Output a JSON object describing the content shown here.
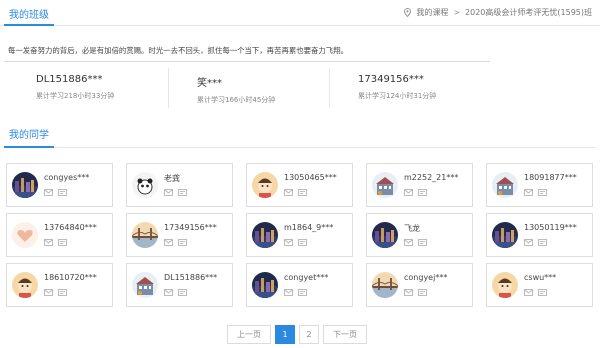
{
  "header": {
    "title": "我的班级",
    "breadcrumb": {
      "home": "我的课程",
      "separator": ">",
      "current": "2020高级会计师考评无忧(1595)班"
    }
  },
  "motto": "每一发奋努力的背后，必是有加倍的赏赐。时光一去不回头，抓住每一个当下，再苦再累也要奋力飞翔。",
  "top_learners": [
    {
      "name": "DL151886***",
      "time": "累计学习218小时33分钟"
    },
    {
      "name": "笑***",
      "time": "累计学习166小时45分钟"
    },
    {
      "name": "17349156***",
      "time": "累计学习124小时31分钟"
    }
  ],
  "classmates_title": "我的同学",
  "classmates": [
    {
      "name": "congyes***",
      "avatar": "city-night"
    },
    {
      "name": "老龚",
      "avatar": "panda-sketch"
    },
    {
      "name": "13050465***",
      "avatar": "cartoon-kid"
    },
    {
      "name": "m2252_21***",
      "avatar": "cartoon-building"
    },
    {
      "name": "18091877***",
      "avatar": "cartoon-building"
    },
    {
      "name": "13764840***",
      "avatar": "heart-hands"
    },
    {
      "name": "17349156***",
      "avatar": "bridge-sunset"
    },
    {
      "name": "m1864_9***",
      "avatar": "city-night"
    },
    {
      "name": "飞龙",
      "avatar": "city-night"
    },
    {
      "name": "13050119***",
      "avatar": "city-night"
    },
    {
      "name": "18610720***",
      "avatar": "cartoon-kid"
    },
    {
      "name": "DL151886***",
      "avatar": "cartoon-building"
    },
    {
      "name": "congyet***",
      "avatar": "city-night"
    },
    {
      "name": "congyej***",
      "avatar": "bridge-sunset"
    },
    {
      "name": "cswu***",
      "avatar": "cartoon-kid"
    }
  ],
  "pagination": {
    "prev": "上一页",
    "pages": [
      "1",
      "2"
    ],
    "current": "1",
    "next": "下一页"
  },
  "colors": {
    "accent": "#2a8ae2",
    "border": "#dedede",
    "text": "#333333",
    "muted": "#888888"
  },
  "icons": {
    "location": "location-pin-icon",
    "mail": "mail-icon",
    "message": "message-icon"
  }
}
